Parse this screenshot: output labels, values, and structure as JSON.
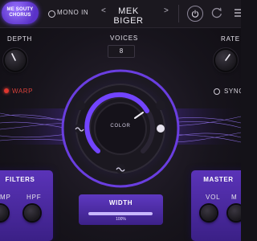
{
  "header": {
    "logo_line1": "ME SOUTY",
    "logo_line2": "CHORUS",
    "mono_label": "MONO IN",
    "preset_prev": "<",
    "preset_name": "MEK BIGER",
    "preset_next": ">"
  },
  "controls": {
    "depth_label": "DEPTH",
    "voices_label": "VOICES",
    "voices_value": "8",
    "rate_label": "RATE",
    "warp_label": "WARP",
    "sync_label": "SYNC",
    "color_label": "COLOR"
  },
  "panels": {
    "filters_title": "FILTERS",
    "filters_left_label": "MP",
    "filters_right_label": "HPF",
    "width_title": "WIDTH",
    "width_value_text": "100%",
    "width_value": 1.0,
    "master_title": "MASTER",
    "master_left_label": "VOL",
    "master_right_label": "M"
  },
  "colors": {
    "accent": "#6a3ee0",
    "warp_on": "#e0362e",
    "background": "#17141c"
  },
  "icons": [
    "power-icon",
    "refresh-icon",
    "menu-icon",
    "wave-icon",
    "mod-icon",
    "tilde-icon"
  ]
}
